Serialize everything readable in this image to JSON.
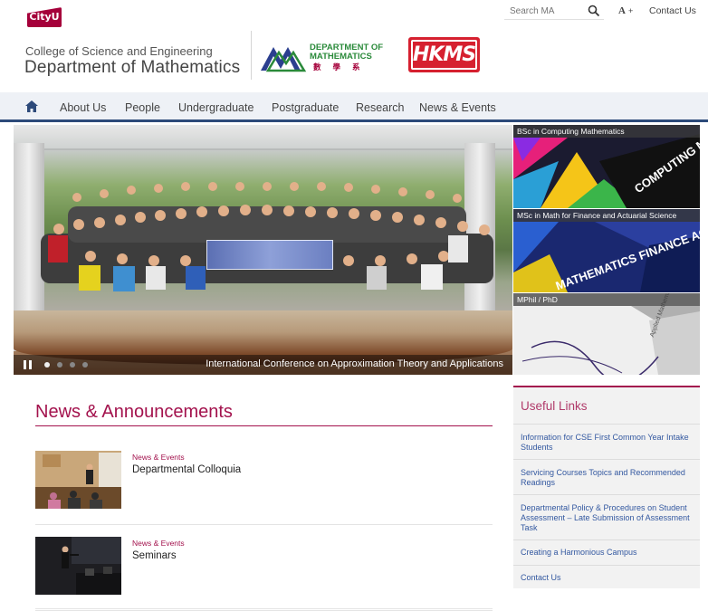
{
  "header": {
    "cityu_logo_text": "CityU",
    "college": "College of Science and Engineering",
    "department": "Department of Mathematics",
    "dm_logo_line1": "DEPARTMENT OF",
    "dm_logo_line2": "MATHEMATICS",
    "dm_logo_chinese": "數學系",
    "hkms_logo_text": "HKMS",
    "search_placeholder": "Search MA",
    "font_size_label": "A",
    "font_size_plus": "+",
    "contact_us": "Contact Us"
  },
  "nav": {
    "items": [
      {
        "label": "About Us"
      },
      {
        "label": "People"
      },
      {
        "label": "Undergraduate"
      },
      {
        "label": "Postgraduate"
      },
      {
        "label": "Research"
      },
      {
        "label": "News & Events"
      }
    ]
  },
  "hero": {
    "caption": "International Conference on Approximation Theory and Applications",
    "slide_count": 4,
    "active_slide": 1
  },
  "tiles": [
    {
      "label": "BSc in Computing Mathematics",
      "art_text": "COMPUTING MATHEMATICS"
    },
    {
      "label": "MSc in Math for Finance and Actuarial Science",
      "art_text": "MATHEMATICS FINANCE ACTUARIAL"
    },
    {
      "label": "MPhil / PhD",
      "art_text": "Applied Mathematics"
    }
  ],
  "news": {
    "heading": "News & Announcements",
    "items": [
      {
        "category": "News & Events",
        "title": "Departmental Colloquia"
      },
      {
        "category": "News & Events",
        "title": "Seminars"
      }
    ]
  },
  "useful_links": {
    "heading": "Useful Links",
    "items": [
      {
        "label": "Information for CSE First Common Year Intake Students"
      },
      {
        "label": "Servicing Courses Topics and Recommended Readings"
      },
      {
        "label": "Departmental Policy & Procedures on Student Assessment – Late Submission of Assessment Task"
      },
      {
        "label": "Creating a Harmonious Campus"
      },
      {
        "label": "Contact Us"
      }
    ]
  },
  "colors": {
    "brand_maroon": "#a3124d",
    "nav_underline": "#2d4a7a",
    "link_blue": "#3358a0",
    "dm_green": "#2a8a3a",
    "hkms_red": "#d6202f"
  }
}
